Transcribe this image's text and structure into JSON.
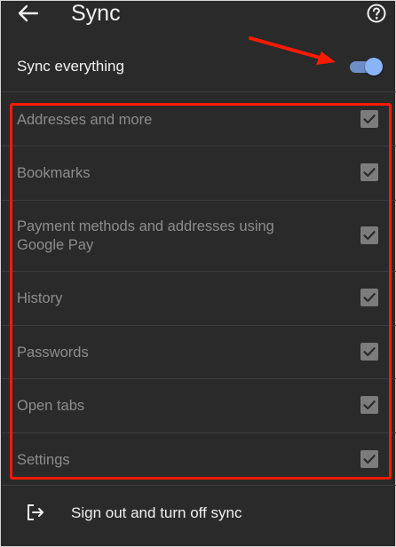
{
  "header": {
    "title": "Sync",
    "back_icon": "arrow-back-icon",
    "help_icon": "help-circle-icon"
  },
  "sync_everything": {
    "label": "Sync everything",
    "enabled": true,
    "toggle_color": "#8ab4f8"
  },
  "items": [
    {
      "label": "Addresses and more",
      "checked": true
    },
    {
      "label": "Bookmarks",
      "checked": true
    },
    {
      "label": "Payment methods and addresses using Google Pay",
      "checked": true
    },
    {
      "label": "History",
      "checked": true
    },
    {
      "label": "Passwords",
      "checked": true
    },
    {
      "label": "Open tabs",
      "checked": true
    },
    {
      "label": "Settings",
      "checked": true
    }
  ],
  "sign_out": {
    "label": "Sign out and turn off sync",
    "icon": "logout-icon"
  },
  "annotation": {
    "highlight_color": "#ff1a00",
    "arrow_color": "#ff1a00"
  }
}
